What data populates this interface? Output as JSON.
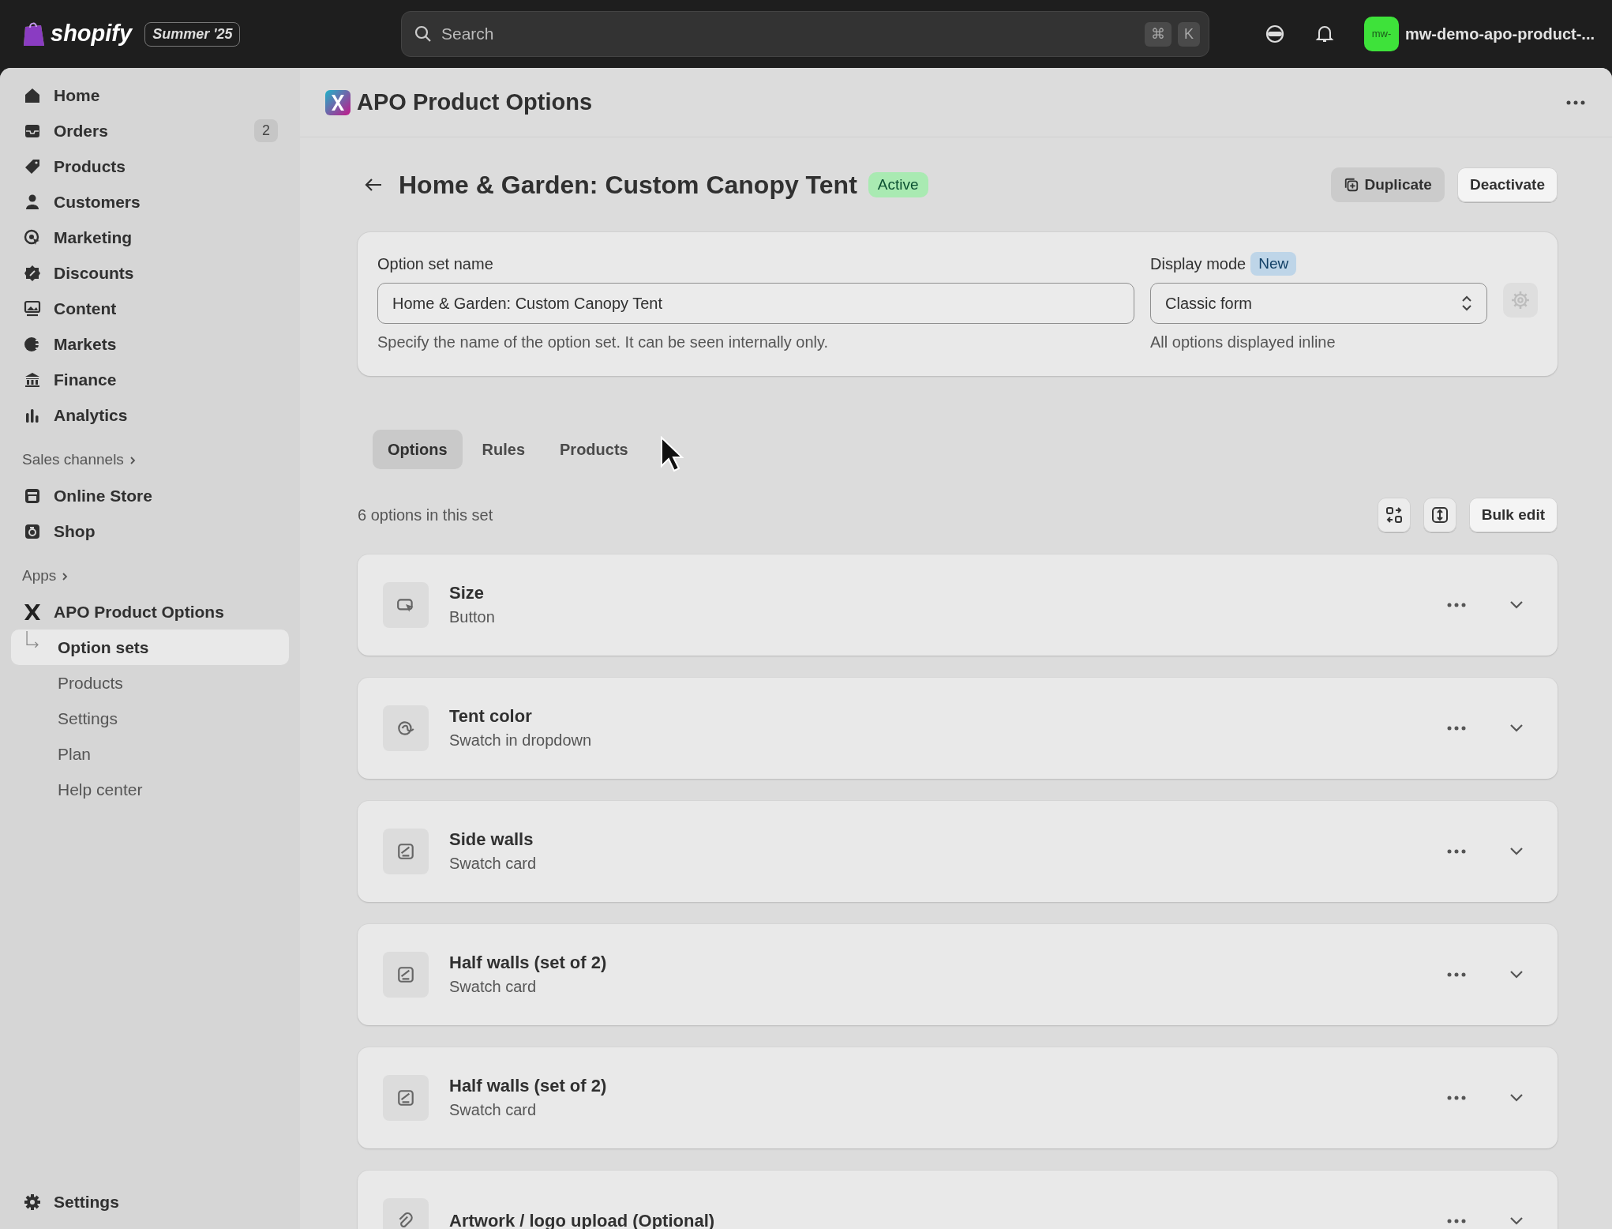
{
  "topbar": {
    "logo_text": "shopify",
    "edition": "Summer '25",
    "search": {
      "placeholder": "Search",
      "keys": [
        "⌘",
        "K"
      ]
    },
    "store_avatar": "mw-",
    "store_name": "mw-demo-apo-product-..."
  },
  "sidebar": {
    "items": [
      {
        "label": "Home",
        "selected": false
      },
      {
        "label": "Orders",
        "selected": false,
        "badge": "2"
      },
      {
        "label": "Products",
        "selected": false
      },
      {
        "label": "Customers",
        "selected": false
      },
      {
        "label": "Marketing",
        "selected": false
      },
      {
        "label": "Discounts",
        "selected": false
      },
      {
        "label": "Content",
        "selected": false
      },
      {
        "label": "Markets",
        "selected": false
      },
      {
        "label": "Finance",
        "selected": false
      },
      {
        "label": "Analytics",
        "selected": false
      }
    ],
    "sales_channels": {
      "heading": "Sales channels",
      "items": [
        {
          "label": "Online Store",
          "selected": false
        },
        {
          "label": "Shop",
          "selected": false
        }
      ]
    },
    "apps": {
      "heading": "Apps",
      "app": {
        "label": "APO Product Options",
        "children": [
          {
            "label": "Option sets",
            "selected": true
          },
          {
            "label": "Products",
            "selected": false
          },
          {
            "label": "Settings",
            "selected": false
          },
          {
            "label": "Plan",
            "selected": false
          },
          {
            "label": "Help center",
            "selected": false
          }
        ]
      }
    },
    "footer": {
      "label": "Settings"
    }
  },
  "app_header": {
    "title": "APO Product Options"
  },
  "page": {
    "title": "Home & Garden: Custom Canopy Tent",
    "status": "Active",
    "actions": [
      {
        "label": "Duplicate",
        "kind": "tinted"
      },
      {
        "label": "Deactivate",
        "kind": "outline"
      }
    ]
  },
  "form": {
    "name_field": {
      "label": "Option set name",
      "value": "Home & Garden: Custom Canopy Tent",
      "help": "Specify the name of the option set. It can be seen internally only."
    },
    "display_mode": {
      "label": "Display mode",
      "badge": "New",
      "value": "Classic form",
      "help": "All options displayed inline",
      "settings_disabled": true
    }
  },
  "tabs": [
    {
      "label": "Options",
      "selected": true
    },
    {
      "label": "Rules",
      "selected": false
    },
    {
      "label": "Products",
      "selected": false
    }
  ],
  "count_text": "6 options in this set",
  "bulk_edit": "Bulk edit",
  "options": [
    {
      "title": "Size",
      "subtitle": "Button",
      "kind": "button"
    },
    {
      "title": "Tent color",
      "subtitle": "Swatch in dropdown",
      "kind": "swatch-dropdown"
    },
    {
      "title": "Side walls",
      "subtitle": "Swatch card",
      "kind": "swatch-card"
    },
    {
      "title": "Half walls (set of 2)",
      "subtitle": "Swatch card",
      "kind": "swatch-card"
    },
    {
      "title": "Half walls (set of 2)",
      "subtitle": "Swatch card",
      "kind": "swatch-card"
    },
    {
      "title": "Artwork / logo upload (Optional)",
      "kind": "file-upload"
    }
  ]
}
